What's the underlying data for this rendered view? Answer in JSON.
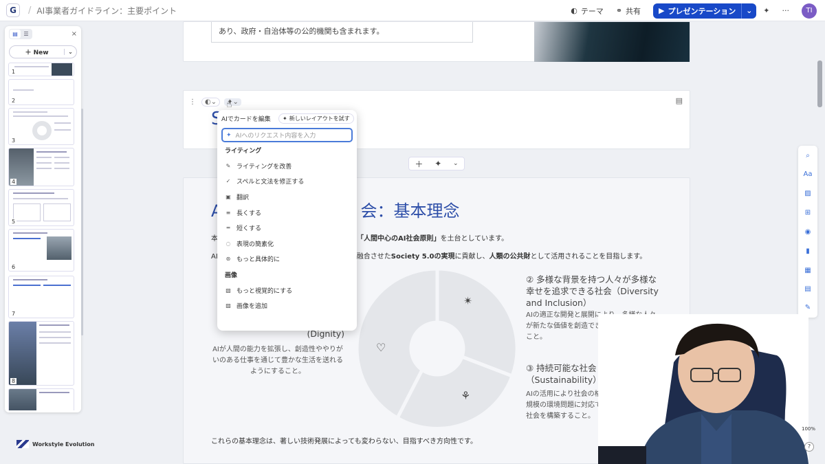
{
  "header": {
    "logo": "G",
    "doc_title": "AI事業者ガイドライン：主要ポイント",
    "theme_label": "テーマ",
    "share_label": "共有",
    "present_label": "プレゼンテーション",
    "more_label": "···",
    "avatar_initials": "TI"
  },
  "sidebar": {
    "new_label": "New",
    "close_label": "×",
    "slides": [
      "1",
      "2",
      "3",
      "4",
      "5",
      "6",
      "7",
      "8"
    ],
    "brand": "Workstyle Evolution"
  },
  "card1": {
    "text": "あり、政府・自治体等の公的機関も含まれます。"
  },
  "card2": {
    "letter": "S"
  },
  "card3": {
    "heading_a": "AI",
    "heading_b": "会：基本理念",
    "line1_a": "本",
    "line1_bold": "「人間中心のAI社会原則」",
    "line1_b": "を土台としています。",
    "line2_a": "AI",
    "line2_b": "融合させた",
    "line2_bold1": "Society 5.0の実現",
    "line2_c": "に貢献し、",
    "line2_bold2": "人類の公共財",
    "line2_d": "として活用されることを目指します。",
    "left_title": "(Dignity)",
    "left_body": "AIが人間の能力を拡張し、創造性ややりがいのある仕事を通じて豊かな生活を送れるようにすること。",
    "r2_title": "② 多様な背景を持つ人々が多様な幸せを追求できる社会（Diversity and Inclusion）",
    "r2_body": "AIの適正な開発と展開により、多様な人々が新たな価値を創造できる社会に変革すること。",
    "r3_title": "③ 持続可能な社会（Sustainability）",
    "r3_body": "AIの活用により社会の格差を解消し、地球規模の環境問題に対応できる持続性のある社会を構築すること。",
    "footer": "これらの基本理念は、著しい技術発展によっても変わらない、目指すべき方向性です。"
  },
  "popup": {
    "title": "AIでカードを編集",
    "try_layout": "新しいレイアウトを試す",
    "input_placeholder": "AIへのリクエスト内容を入力",
    "section_writing": "ライティング",
    "items_writing": [
      "ライティングを改善",
      "スペルと文法を修正する",
      "翻訳",
      "長くする",
      "短くする",
      "表現の簡素化",
      "もっと具体的に"
    ],
    "section_image": "画像",
    "items_image": [
      "もっと視覚的にする",
      "画像を追加"
    ]
  },
  "zoom_label": "100%",
  "help_label": "?",
  "colors": {
    "accent": "#1849c8",
    "heading": "#2d4ea8",
    "donut": "#e4e6ea"
  }
}
